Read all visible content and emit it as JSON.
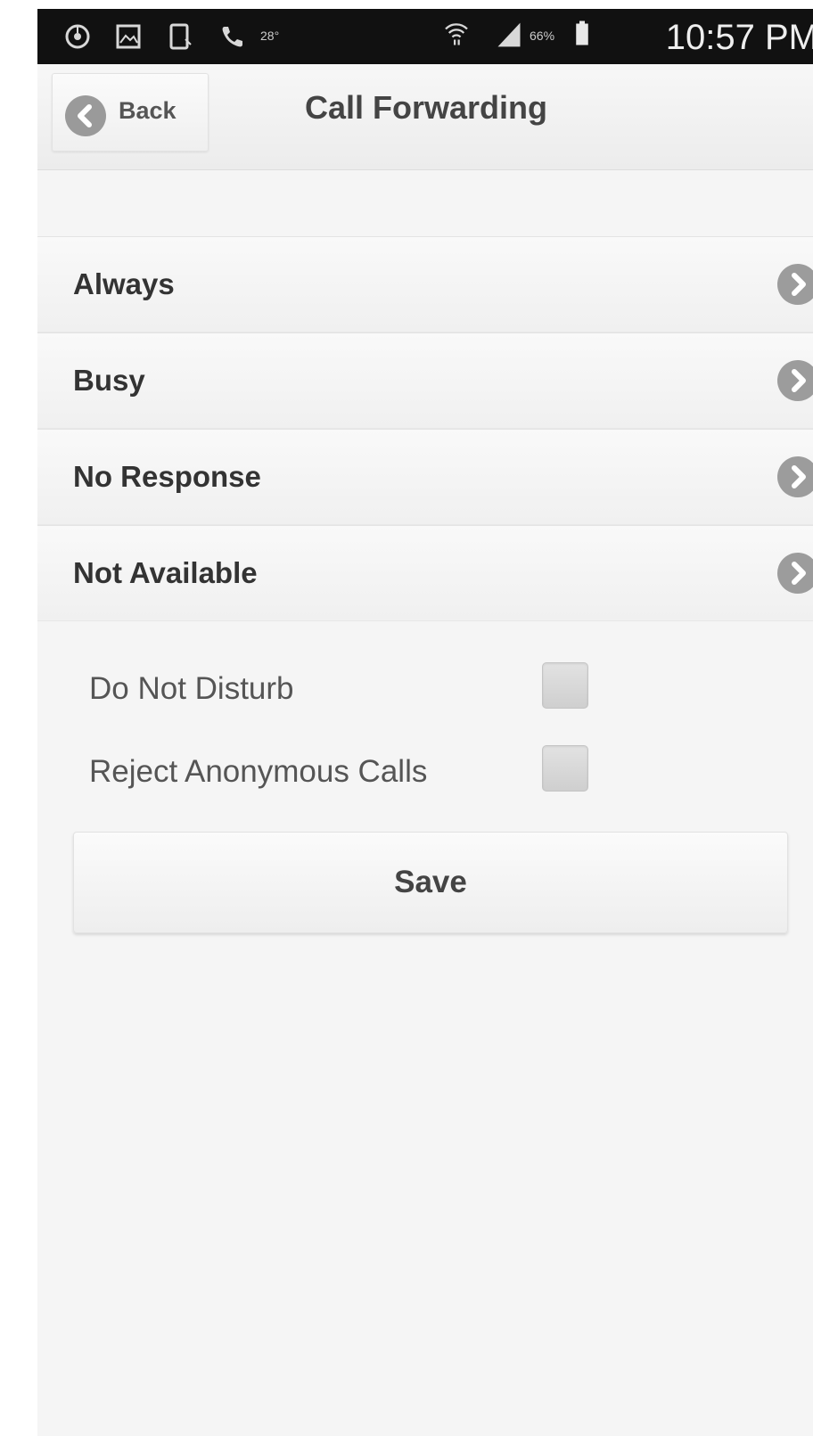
{
  "status_bar": {
    "time": "10:57 PM",
    "battery_percent": "66%",
    "temperature": "28°",
    "icons": [
      "chrome-icon",
      "image-icon",
      "screenshot-icon",
      "phone-icon",
      "wifi-icon",
      "signal-icon",
      "battery-icon"
    ]
  },
  "header": {
    "back_label": "Back",
    "title": "Call Forwarding"
  },
  "forward_list": {
    "items": [
      {
        "label": "Always"
      },
      {
        "label": "Busy"
      },
      {
        "label": "No Response"
      },
      {
        "label": "Not Available"
      }
    ]
  },
  "options": {
    "do_not_disturb": {
      "label": "Do Not Disturb",
      "checked": false
    },
    "reject_anonymous": {
      "label": "Reject Anonymous Calls",
      "checked": false
    }
  },
  "save": {
    "label": "Save"
  }
}
